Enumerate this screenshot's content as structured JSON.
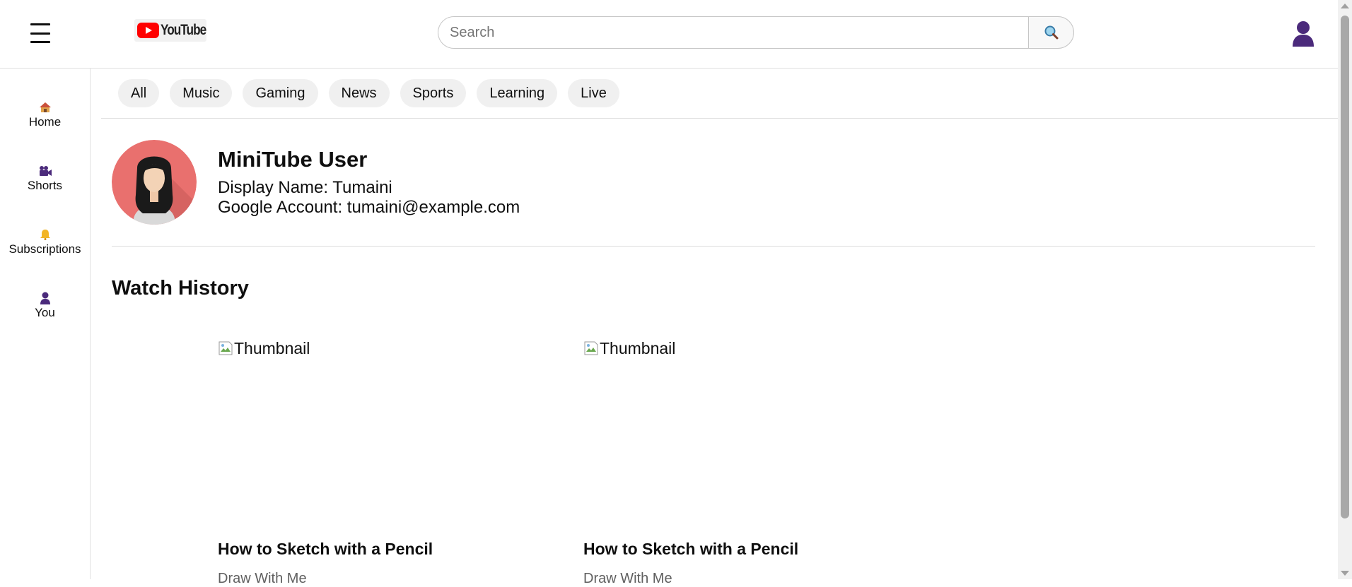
{
  "header": {
    "logo_text": "YouTube",
    "search_placeholder": "Search"
  },
  "sidebar": {
    "items": [
      {
        "icon": "home-icon",
        "label": "Home"
      },
      {
        "icon": "shorts-icon",
        "label": "Shorts"
      },
      {
        "icon": "bell-icon",
        "label": "Subscriptions"
      },
      {
        "icon": "user-icon",
        "label": "You"
      }
    ]
  },
  "chips": [
    "All",
    "Music",
    "Gaming",
    "News",
    "Sports",
    "Learning",
    "Live"
  ],
  "profile": {
    "name": "MiniTube User",
    "display_name_line": "Display Name: Tumaini",
    "account_line": "Google Account: tumaini@example.com"
  },
  "history": {
    "title": "Watch History",
    "videos": [
      {
        "thumbnail_alt": "Thumbnail",
        "title": "How to Sketch with a Pencil",
        "channel": "Draw With Me"
      },
      {
        "thumbnail_alt": "Thumbnail",
        "title": "How to Sketch with a Pencil",
        "channel": "Draw With Me"
      }
    ]
  },
  "colors": {
    "brand_red": "#ff0000",
    "icon_purple": "#4b2a7b",
    "chip_bg": "#f0f0f0",
    "avatar_bg": "#e9706e"
  }
}
